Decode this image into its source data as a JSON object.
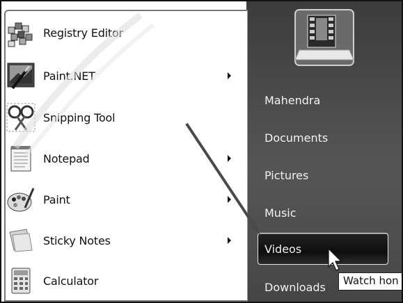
{
  "left_menu": {
    "items": [
      {
        "label": "Registry Editor",
        "icon": "registry-editor-icon",
        "has_submenu": false
      },
      {
        "label": "Paint.NET",
        "icon": "paint-net-icon",
        "has_submenu": true
      },
      {
        "label": "Snipping Tool",
        "icon": "snipping-tool-icon",
        "has_submenu": false
      },
      {
        "label": "Notepad",
        "icon": "notepad-icon",
        "has_submenu": true
      },
      {
        "label": "Paint",
        "icon": "paint-icon",
        "has_submenu": true
      },
      {
        "label": "Sticky Notes",
        "icon": "sticky-notes-icon",
        "has_submenu": true
      },
      {
        "label": "Calculator",
        "icon": "calculator-icon",
        "has_submenu": false
      }
    ]
  },
  "right_menu": {
    "user_picture_icon": "film-strip-user-icon",
    "items": [
      {
        "label": "Mahendra"
      },
      {
        "label": "Documents"
      },
      {
        "label": "Pictures"
      },
      {
        "label": "Music"
      },
      {
        "label": "Videos",
        "highlighted": true
      },
      {
        "label": "Downloads"
      }
    ]
  },
  "tooltip": {
    "text": "Watch hon"
  },
  "annotation": {
    "arrow_icon": "pointer-arrow-annotation"
  },
  "colors": {
    "right_pane": "#4a4a4a",
    "right_text": "#f2f2f2",
    "left_pane": "#ffffff"
  }
}
